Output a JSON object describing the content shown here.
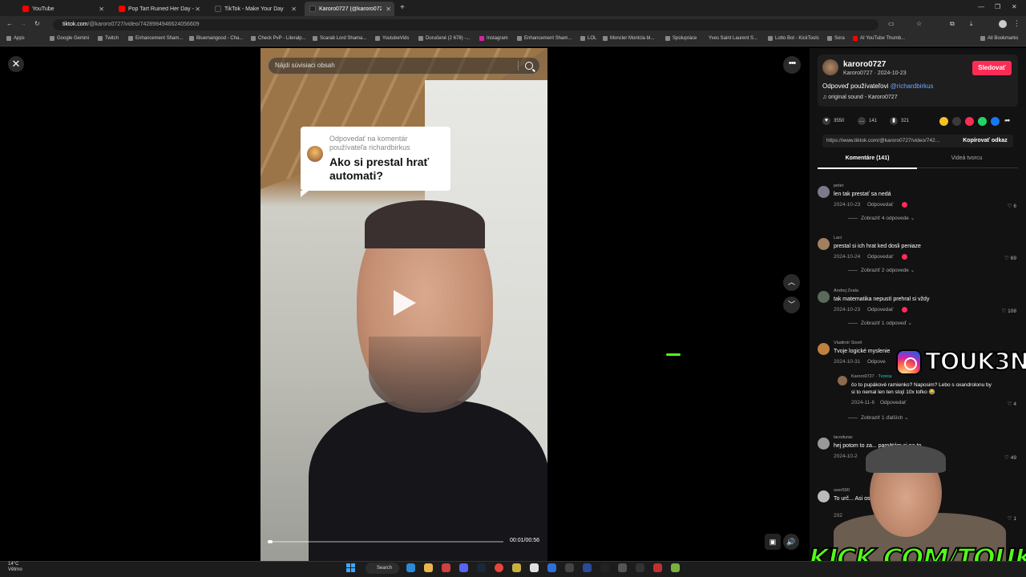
{
  "browser": {
    "tabs": [
      {
        "label": "YouTube",
        "color": "#ff0000"
      },
      {
        "label": "Pop Tart Ruined Her Day - YouT",
        "color": "#ff0000"
      },
      {
        "label": "TikTok - Make Your Day",
        "color": "#222222"
      },
      {
        "label": "Karoro0727 (@karoro0727)",
        "color": "#222222"
      }
    ],
    "url_host": "tiktok.com",
    "url_path": "/@karoro0727/video/7428984946624056609",
    "bookmarks": [
      "Apps",
      "Google Gemini",
      "Twitch",
      "Enhancement Sham...",
      "Bluemangood - Cha...",
      "Check PvP - Literalp...",
      "Scarab Lord Shama...",
      "YoutubeVids",
      "Doručené (2 678) -...",
      "Instagram",
      "Enhancement Sham...",
      "LOL",
      "Moncler Montcla bl...",
      "Spolupráce",
      "Yves Saint Laurent S...",
      "Lotto Bot - KickTools",
      "Sora",
      "AI YouTube Thumb...",
      "All Bookmarks"
    ]
  },
  "video": {
    "search_placeholder": "Nájdi súvisiaci obsah",
    "reply_label": "Odpovedať na komentár používateľa richardbirkus",
    "reply_text": "Ako si prestal hrať automati?",
    "time": "00:01/00:56",
    "progress": 0.02
  },
  "creator": {
    "name": "karoro0727",
    "meta": "Karoro0727 · 2024-10-23",
    "follow_label": "Sledovať",
    "caption_prefix": "Odpoveď používateľovi ",
    "caption_mention": "@richardbirkus",
    "sound": "original sound - Karoro0727"
  },
  "actions": {
    "likes": "3550",
    "comments": "141",
    "saves": "321"
  },
  "share_colors": [
    "#f6c026",
    "#3a3a3a",
    "#fe2c55",
    "#25d366",
    "#1877f2",
    "#3a3a3a"
  ],
  "link": {
    "url": "https://www.tiktok.com/@karoro0727/video/742...",
    "copy_label": "Kopírovať odkaz"
  },
  "comment_tabs": [
    "Komentáre (141)",
    "Videá tvorcu"
  ],
  "comments": [
    {
      "user": "peter",
      "text": "len tak prestať sa nedá",
      "date": "2024-10-23",
      "reply": "Odpovedať",
      "likes": "6",
      "more": "Zobraziť 4 odpovede",
      "avatar": "#7a7a8a"
    },
    {
      "user": "Laci",
      "text": "prestal si ich hrat ked dosli peniaze",
      "date": "2024-10-24",
      "reply": "Odpovedať",
      "likes": "69",
      "more": "Zobraziť 2 odpovede",
      "avatar": "#a08060"
    },
    {
      "user": "Andrej Zvala",
      "text": "tak matematika nepustí prehral si vždy",
      "date": "2024-10-23",
      "reply": "Odpovedať",
      "likes": "108",
      "more": "Zobraziť 1 odpoveď",
      "avatar": "#5a6a5a"
    },
    {
      "user": "Vladimír Sivoň",
      "text": "Tvoje logické myslenie",
      "date": "2024-10-31",
      "reply": "Odpove",
      "likes": "",
      "more": "Zobraziť 1 ďalších",
      "avatar": "#c08040"
    },
    {
      "user": "lacodurac",
      "text": "hej potom to za... pamätám si na to",
      "date": "2024-10-2",
      "reply": "",
      "likes": "49",
      "more": "",
      "avatar": "#999999"
    },
    {
      "user": "user590",
      "text": "To urč... Asi osmnáct let nehraj...",
      "date": "202",
      "reply": "",
      "likes": "1",
      "more": "",
      "avatar": "#bbbbbb"
    }
  ],
  "creator_reply": {
    "user": "Karoro0727",
    "badge": "Tvorca",
    "text": "čo to pupákové ramienko? Naposim? Lebo s oxandrolonu by si to nemal len ten stojí 10x toľko 😂",
    "date": "2024-11-6",
    "reply": "Odpovedať",
    "likes": "4"
  },
  "overlay": {
    "ig_handle": "TOUK3N",
    "kick": "KICK.COM/TOUKEN"
  },
  "taskbar": {
    "temp": "14°C",
    "weather": "Větrno",
    "search": "Search"
  }
}
